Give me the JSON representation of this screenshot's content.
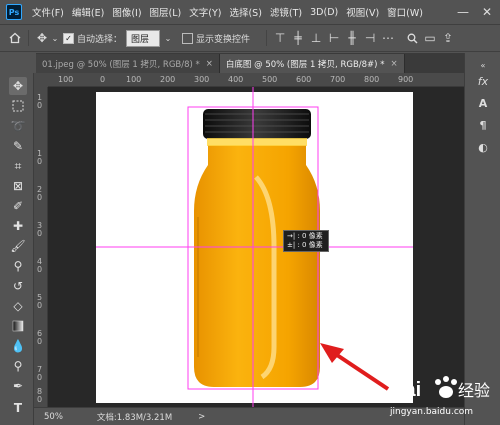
{
  "app": {
    "logo": "Ps"
  },
  "menubar": {
    "items": [
      "文件(F)",
      "编辑(E)",
      "图像(I)",
      "图层(L)",
      "文字(Y)",
      "选择(S)",
      "滤镜(T)",
      "3D(D)",
      "视图(V)",
      "窗口(W)"
    ],
    "minimize": "—",
    "close": "✕"
  },
  "options": {
    "auto_select_label": "自动选择：",
    "auto_select_value": "图层",
    "transform_label": "显示变换控件"
  },
  "tabs": [
    {
      "label": "01.jpeg @ 50% (图层 1 拷贝, RGB/8) *",
      "close": "×"
    },
    {
      "label": "白底图 @ 50% (图层 1 拷贝, RGB/8#) *",
      "close": "×"
    }
  ],
  "ruler": {
    "h_labels": [
      "100",
      "0",
      "100",
      "200",
      "300",
      "400",
      "500",
      "600",
      "700",
      "800",
      "900"
    ],
    "v_labels": [
      "1",
      "0",
      "1",
      "0",
      "2",
      "0",
      "3",
      "0",
      "4",
      "0",
      "5",
      "0",
      "6",
      "0",
      "7",
      "0",
      "8",
      "0"
    ]
  },
  "tooltip": {
    "line1": "→| : 0 像素",
    "line2": "±| : 0 像素"
  },
  "status": {
    "zoom": "50%",
    "doc_info": "文档:1.83M/3.21M",
    "arrow": ">"
  },
  "watermark": {
    "brand": "Bai",
    "brand_cn": "经验",
    "url": "jingyan.baidu.com"
  },
  "colors": {
    "accent_guides": "#ff3df0",
    "arrow_red": "#e01d1d",
    "juice": "#f6a800",
    "cap": "#1a1a1a"
  }
}
